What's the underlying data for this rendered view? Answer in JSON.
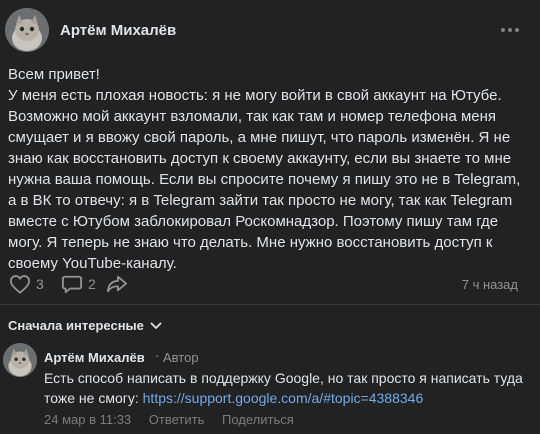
{
  "post": {
    "author": "Артём Михалёв",
    "paragraphs": [
      "Всем привет!",
      "У меня есть плохая новость: я не могу войти в свой аккаунт на Ютубе.",
      "Возможно мой аккаунт взломали, так как там и номер телефона меня смущает и я ввожу свой пароль, а мне пишут, что пароль изменён. Я не знаю как восстановить доступ к своему аккаунту, если вы знаете то мне нужна ваша помощь. Если вы спросите почему я пишу это не в Telegram, а в ВК то отвечу: я в Telegram зайти так просто не могу, так как Telegram вместе с Ютубом заблокировал Роскомнадзор. Поэтому пишу там где могу. Я теперь не знаю что делать. Мне нужно восстановить доступ к своему YouTube-каналу."
    ],
    "likes": "3",
    "comments": "2",
    "time": "7 ч назад"
  },
  "sort_label": "Сначала интересные",
  "comment": {
    "author": "Артём Михалёв",
    "separator": "·",
    "role": "Автор",
    "text": "Есть способ написать в поддержку Google, но так просто я написать туда тоже не смогу: ",
    "link": "https://support.google.com/a/#topic=4388346",
    "date": "24 мар в 11:33",
    "reply_label": "Ответить",
    "share_label": "Поделиться"
  },
  "colors": {
    "background": "#222222",
    "text": "#e1e3e6",
    "secondary": "#939393",
    "link": "#71aaeb"
  },
  "icons": [
    "more-icon",
    "like-icon",
    "comment-icon",
    "share-icon",
    "chevron-down-icon"
  ]
}
